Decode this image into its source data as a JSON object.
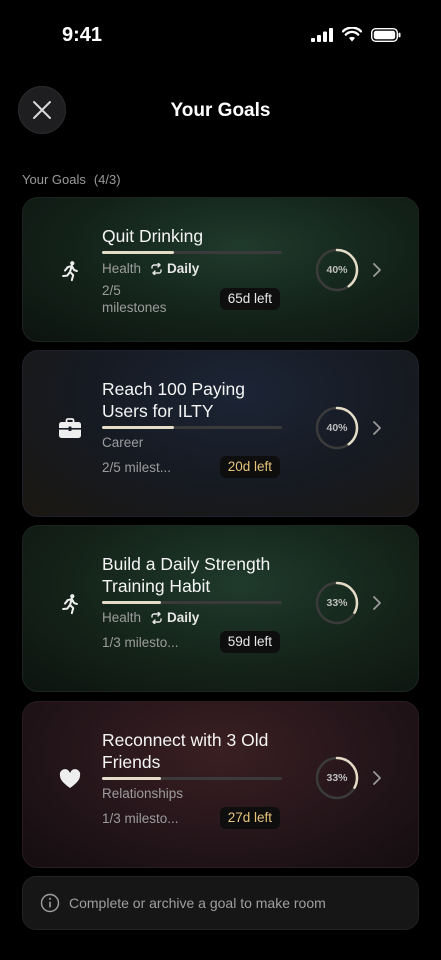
{
  "status": {
    "time": "9:41"
  },
  "header": {
    "title": "Your Goals"
  },
  "section": {
    "label": "Your Goals",
    "count": "(4/3)"
  },
  "goals": [
    {
      "title": "Quit Drinking",
      "category": "Health",
      "frequency": "Daily",
      "milestones": "2/5\nmilestones",
      "days_left": "65d left",
      "percent_label": "40%",
      "percent": 40,
      "bar_fraction": 0.4,
      "icon": "running-icon",
      "days_color": "#e8e8e8"
    },
    {
      "title": "Reach 100 Paying Users for ILTY",
      "category": "Career",
      "frequency": "",
      "milestones": "2/5 milest...",
      "days_left": "20d left",
      "percent_label": "40%",
      "percent": 40,
      "bar_fraction": 0.4,
      "icon": "briefcase-icon",
      "days_color": "#e7c47a"
    },
    {
      "title": "Build a Daily Strength Training Habit",
      "category": "Health",
      "frequency": "Daily",
      "milestones": "1/3 milesto...",
      "days_left": "59d left",
      "percent_label": "33%",
      "percent": 33,
      "bar_fraction": 0.33,
      "icon": "running-icon",
      "days_color": "#e8e8e8"
    },
    {
      "title": "Reconnect with 3 Old Friends",
      "category": "Relationships",
      "frequency": "",
      "milestones": "1/3 milesto...",
      "days_left": "27d left",
      "percent_label": "33%",
      "percent": 33,
      "bar_fraction": 0.33,
      "icon": "heart-icon",
      "days_color": "#e7c47a"
    }
  ],
  "footer": {
    "note": "Complete or archive a goal to make room"
  },
  "colors": {
    "progress_fill": "#e5dcc8",
    "gold": "#e7c47a"
  }
}
